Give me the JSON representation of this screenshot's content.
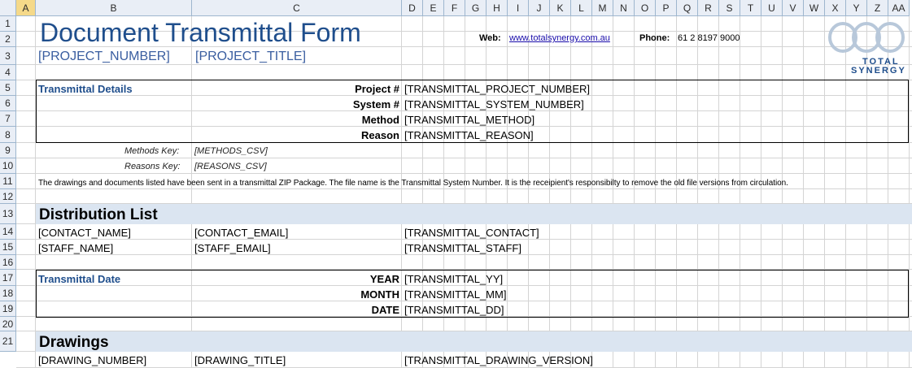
{
  "columns": [
    "A",
    "B",
    "C",
    "D",
    "E",
    "F",
    "G",
    "H",
    "I",
    "J",
    "K",
    "L",
    "M",
    "N",
    "O",
    "P",
    "Q",
    "R",
    "S",
    "T",
    "U",
    "V",
    "W",
    "X",
    "Y",
    "Z",
    "AA"
  ],
  "rows": [
    "1",
    "2",
    "3",
    "4",
    "5",
    "6",
    "7",
    "8",
    "9",
    "10",
    "11",
    "12",
    "13",
    "14",
    "15",
    "16",
    "17",
    "18",
    "19",
    "20",
    "21"
  ],
  "header": {
    "title": "Document Transmittal Form",
    "project_number": "[PROJECT_NUMBER]",
    "project_title": "[PROJECT_TITLE]",
    "web_label": "Web:",
    "web_url": "www.totalsynergy.com.au",
    "phone_label": "Phone:",
    "phone_value": "61 2 8197 9000",
    "logo_line1": "TOTAL",
    "logo_line2": "SYNERGY"
  },
  "details": {
    "section": "Transmittal Details",
    "labels": [
      "Project #",
      "System #",
      "Method",
      "Reason"
    ],
    "values": [
      "[TRANSMITTAL_PROJECT_NUMBER]",
      "[TRANSMITTAL_SYSTEM_NUMBER]",
      "[TRANSMITTAL_METHOD]",
      "[TRANSMITTAL_REASON]"
    ]
  },
  "keys": {
    "methods_label": "Methods Key:",
    "methods_value": "[METHODS_CSV]",
    "reasons_label": "Reasons Key:",
    "reasons_value": "[REASONS_CSV]"
  },
  "note": "The drawings and documents listed have been sent in a transmittal ZIP Package. The file name is the Transmittal System Number. It is the receipient's responsibilty to remove the old file versions from circulation.",
  "distribution": {
    "heading": "Distribution List",
    "rows": [
      [
        "[CONTACT_NAME]",
        "[CONTACT_EMAIL]",
        "[TRANSMITTAL_CONTACT]"
      ],
      [
        "[STAFF_NAME]",
        "[STAFF_EMAIL]",
        "[TRANSMITTAL_STAFF]"
      ]
    ]
  },
  "date": {
    "section": "Transmittal Date",
    "labels": [
      "YEAR",
      "MONTH",
      "DATE"
    ],
    "values": [
      "[TRANSMITTAL_YY]",
      "[TRANSMITTAL_MM]",
      "[TRANSMITTAL_DD]"
    ]
  },
  "drawings": {
    "heading": "Drawings",
    "row": [
      "[DRAWING_NUMBER]",
      "[DRAWING_TITLE]",
      "[TRANSMITTAL_DRAWING_VERSION]"
    ]
  }
}
